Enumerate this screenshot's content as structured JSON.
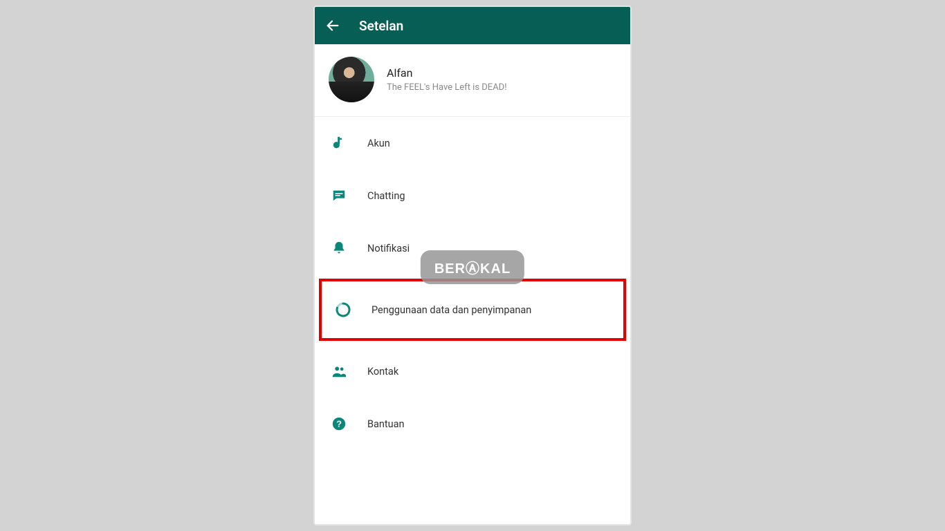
{
  "header": {
    "title": "Setelan"
  },
  "profile": {
    "name": "Alfan",
    "status": "The FEEL's Have Left is DEAD!"
  },
  "menu": {
    "account": "Akun",
    "chats": "Chatting",
    "notifications": "Notifikasi",
    "data_storage": "Penggunaan data dan penyimpanan",
    "contacts": "Kontak",
    "help": "Bantuan"
  },
  "watermark": "BERⒶKAL",
  "colors": {
    "primary": "#075e54",
    "icon": "#0b867a",
    "highlight_border": "#e30000"
  }
}
